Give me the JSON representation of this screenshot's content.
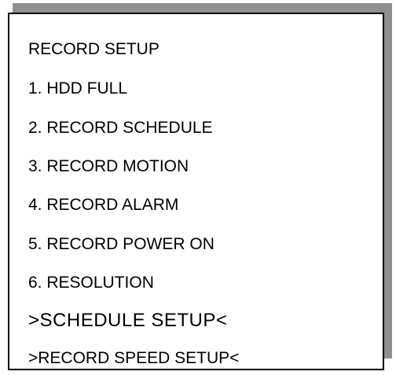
{
  "menu": {
    "title": "RECORD SETUP",
    "items": [
      {
        "label": "1. HDD FULL"
      },
      {
        "label": "2. RECORD SCHEDULE"
      },
      {
        "label": "3. RECORD MOTION"
      },
      {
        "label": "4. RECORD ALARM"
      },
      {
        "label": "5. RECORD POWER ON"
      },
      {
        "label": "6. RESOLUTION"
      },
      {
        "label": ">SCHEDULE SETUP<"
      },
      {
        "label": ">RECORD SPEED SETUP<"
      }
    ]
  },
  "colors": {
    "text": "#000000",
    "panel": "#ffffff",
    "shadow": "#8f8f8f",
    "border": "#000000"
  }
}
